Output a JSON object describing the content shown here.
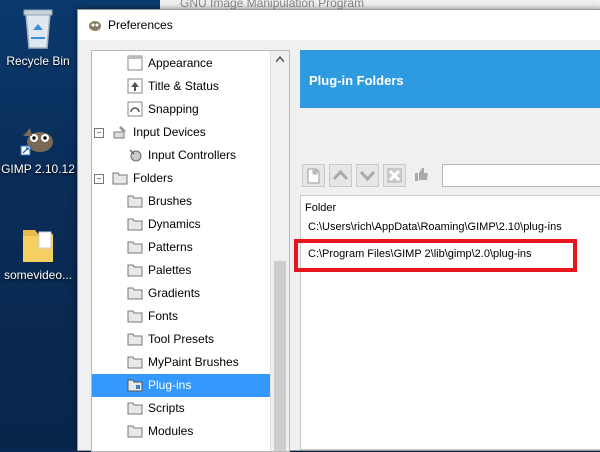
{
  "desktop": {
    "icons": [
      {
        "label": "Recycle Bin",
        "icon": "recycle-bin-icon"
      },
      {
        "label": "GIMP 2.10.12",
        "icon": "gimp-icon"
      },
      {
        "label": "somevideo...",
        "icon": "folder-icon"
      }
    ]
  },
  "background_window": {
    "title": "GNU Image Manipulation Program"
  },
  "window": {
    "title": "Preferences",
    "icon": "gimp-small-icon"
  },
  "tree": {
    "items": [
      {
        "label": "Appearance",
        "icon": "appearance-icon",
        "level": 2
      },
      {
        "label": "Title & Status",
        "icon": "title-status-icon",
        "level": 2
      },
      {
        "label": "Snapping",
        "icon": "snapping-icon",
        "level": 2
      },
      {
        "label": "Input Devices",
        "icon": "input-devices-icon",
        "level": 1,
        "expander": "minus"
      },
      {
        "label": "Input Controllers",
        "icon": "input-controllers-icon",
        "level": 2
      },
      {
        "label": "Folders",
        "icon": "folders-icon",
        "level": 1,
        "expander": "minus"
      },
      {
        "label": "Brushes",
        "icon": "folder-icon",
        "level": 2
      },
      {
        "label": "Dynamics",
        "icon": "folder-icon",
        "level": 2
      },
      {
        "label": "Patterns",
        "icon": "folder-icon",
        "level": 2
      },
      {
        "label": "Palettes",
        "icon": "folder-icon",
        "level": 2
      },
      {
        "label": "Gradients",
        "icon": "folder-icon",
        "level": 2
      },
      {
        "label": "Fonts",
        "icon": "folder-icon",
        "level": 2
      },
      {
        "label": "Tool Presets",
        "icon": "folder-icon",
        "level": 2
      },
      {
        "label": "MyPaint Brushes",
        "icon": "folder-icon",
        "level": 2
      },
      {
        "label": "Plug-ins",
        "icon": "folder-icon",
        "level": 2,
        "selected": true
      },
      {
        "label": "Scripts",
        "icon": "folder-icon",
        "level": 2
      },
      {
        "label": "Modules",
        "icon": "folder-icon",
        "level": 2
      }
    ]
  },
  "panel": {
    "title": "Plug-in Folders",
    "toolbar": [
      "new-folder-icon",
      "move-up-icon",
      "move-down-icon",
      "delete-icon",
      "writable-icon"
    ],
    "list_header": "Folder",
    "folders": [
      "C:\\Users\\rich\\AppData\\Roaming\\GIMP\\2.10\\plug-ins",
      "C:\\Program Files\\GIMP 2\\lib\\gimp\\2.0\\plug-ins"
    ]
  },
  "colors": {
    "accent": "#2e9ae0",
    "selection": "#3399ff",
    "highlight": "#e8141e"
  }
}
